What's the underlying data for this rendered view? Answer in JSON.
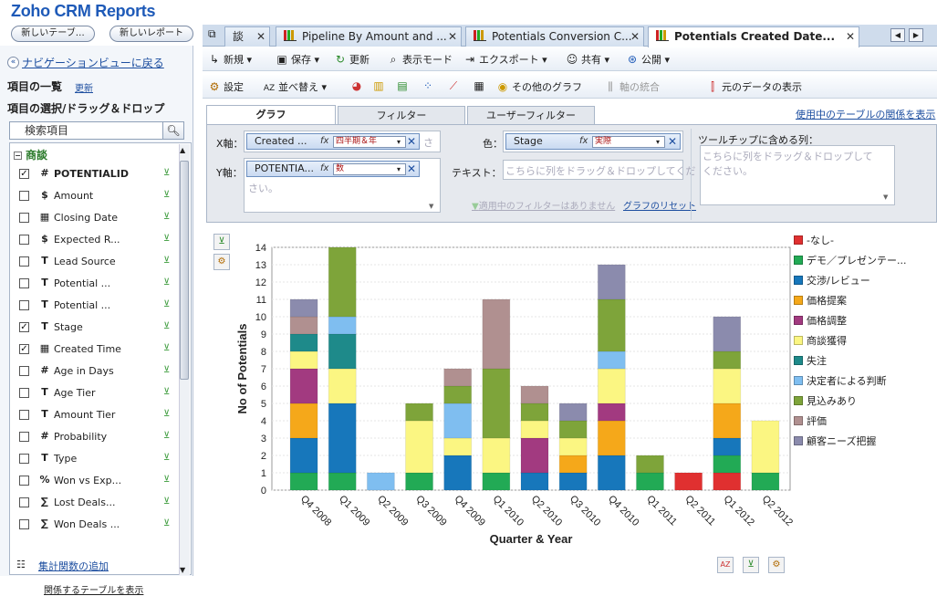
{
  "header": {
    "title": "Zoho CRM Reports",
    "new_table": "新しいテーブ…",
    "new_report": "新しいレポート"
  },
  "sidebar": {
    "nav_back": "ナビゲーションビューに戻る",
    "items_heading": "項目の一覧",
    "refresh": "更新",
    "sub_heading": "項目の選択/ドラッグ＆ドロップ",
    "search_placeholder": "検索項目",
    "group_title": "商談",
    "items": [
      {
        "label": "POTENTIALID",
        "type_icon": "#",
        "checked": true,
        "bold": true
      },
      {
        "label": "Amount",
        "type_icon": "$",
        "checked": false
      },
      {
        "label": "Closing Date",
        "type_icon": "calendar-icon",
        "checked": false
      },
      {
        "label": "Expected R...",
        "type_icon": "$",
        "checked": false
      },
      {
        "label": "Lead Source",
        "type_icon": "T",
        "checked": false
      },
      {
        "label": "Potential ...",
        "type_icon": "T",
        "checked": false
      },
      {
        "label": "Potential ...",
        "type_icon": "T",
        "checked": false
      },
      {
        "label": "Stage",
        "type_icon": "T",
        "checked": true
      },
      {
        "label": "Created Time",
        "type_icon": "calendar-icon",
        "checked": true
      },
      {
        "label": "Age in Days",
        "type_icon": "#",
        "checked": false
      },
      {
        "label": "Age Tier",
        "type_icon": "T",
        "checked": false
      },
      {
        "label": "Amount Tier",
        "type_icon": "T",
        "checked": false
      },
      {
        "label": "Probability",
        "type_icon": "#",
        "checked": false
      },
      {
        "label": "Type",
        "type_icon": "T",
        "checked": false
      },
      {
        "label": "Won vs Exp...",
        "type_icon": "%",
        "checked": false
      },
      {
        "label": "Lost Deals...",
        "type_icon": "formula-icon",
        "checked": false
      },
      {
        "label": "Won Deals ...",
        "type_icon": "formula-icon",
        "checked": false
      }
    ],
    "show_related": "関係するテーブルを表示",
    "add_aggregate": "集計関数の追加"
  },
  "tabs": [
    {
      "label": "談",
      "active": false
    },
    {
      "label": "Pipeline By Amount and ...",
      "active": false
    },
    {
      "label": "Potentials Conversion C...",
      "active": false
    },
    {
      "label": "Potentials Created Date...",
      "active": true
    }
  ],
  "toolbar1": {
    "new": "新規",
    "save": "保存",
    "refresh": "更新",
    "view_mode": "表示モード",
    "export": "エクスポート",
    "share": "共有",
    "publish": "公開"
  },
  "toolbar2": {
    "settings": "設定",
    "sort": "並べ替え",
    "other_charts": "その他のグラフ",
    "axis_merge": "軸の統合",
    "show_data": "元のデータの表示"
  },
  "config": {
    "tabs": [
      "グラフ",
      "フィルター",
      "ユーザーフィルター"
    ],
    "used_tables_link": "使用中のテーブルの関係を表示",
    "x_label": "X軸：",
    "x_pill": "Created ...",
    "x_func": "四半期＆年",
    "x_trailing": "さ",
    "y_label": "Y軸：",
    "y_pill": "POTENTIA...",
    "y_func": "数",
    "y_placeholder": "さい。",
    "color_label": "色：",
    "color_pill": "Stage",
    "color_func": "実際",
    "text_label": "テキスト：",
    "text_placeholder": "こちらに列をドラッグ＆ドロップしてくだ",
    "tooltip_label": "ツールチップに含める列：",
    "tooltip_placeholder": "こちらに列をドラッグ＆ドロップしてください。",
    "no_filter": "適用中のフィルターはありません",
    "reset_chart": "グラフのリセット"
  },
  "chart_data": {
    "type": "bar",
    "stacked": true,
    "xlabel": "Quarter & Year",
    "ylabel": "No of Potentials",
    "ylim": [
      0,
      14
    ],
    "yticks": [
      0,
      1,
      2,
      3,
      4,
      5,
      6,
      7,
      8,
      9,
      10,
      11,
      12,
      13,
      14
    ],
    "grid": true,
    "legend_placement": "right",
    "categories": [
      "Q4 2008",
      "Q1 2009",
      "Q2 2009",
      "Q3 2009",
      "Q4 2009",
      "Q1 2010",
      "Q2 2010",
      "Q3 2010",
      "Q4 2010",
      "Q1 2011",
      "Q2 2011",
      "Q1 2012",
      "Q2 2012"
    ],
    "series": [
      {
        "name": "-なし-",
        "color": "#e03030",
        "values": [
          0,
          0,
          0,
          0,
          0,
          0,
          0,
          0,
          0,
          0,
          1,
          1,
          0
        ]
      },
      {
        "name": "デモ／プレゼンテー...",
        "color": "#22aa55",
        "values": [
          1,
          1,
          0,
          1,
          0,
          1,
          0,
          0,
          0,
          1,
          0,
          1,
          1
        ]
      },
      {
        "name": "交渉/レビュー",
        "color": "#1777bb",
        "values": [
          2,
          4,
          0,
          0,
          2,
          0,
          1,
          1,
          2,
          0,
          0,
          1,
          0
        ]
      },
      {
        "name": "価格提案",
        "color": "#f5a81a",
        "values": [
          2,
          0,
          0,
          0,
          0,
          0,
          0,
          1,
          2,
          0,
          0,
          2,
          0
        ]
      },
      {
        "name": "価格調整",
        "color": "#a23a80",
        "values": [
          2,
          0,
          0,
          0,
          0,
          0,
          2,
          0,
          1,
          0,
          0,
          0,
          0
        ]
      },
      {
        "name": "商談獲得",
        "color": "#fbf682",
        "values": [
          1,
          2,
          0,
          3,
          1,
          2,
          1,
          1,
          2,
          0,
          0,
          2,
          3
        ]
      },
      {
        "name": "失注",
        "color": "#1e8a8a",
        "values": [
          1,
          2,
          0,
          0,
          0,
          0,
          0,
          0,
          0,
          0,
          0,
          0,
          0
        ]
      },
      {
        "name": "決定者による判断",
        "color": "#7fbef0",
        "values": [
          0,
          1,
          1,
          0,
          2,
          0,
          0,
          0,
          1,
          0,
          0,
          0,
          0
        ]
      },
      {
        "name": "見込みあり",
        "color": "#7ea43a",
        "values": [
          0,
          4,
          0,
          1,
          1,
          4,
          1,
          1,
          3,
          1,
          0,
          1,
          0
        ]
      },
      {
        "name": "評価",
        "color": "#b09090",
        "values": [
          1,
          0,
          0,
          0,
          1,
          4,
          1,
          0,
          0,
          0,
          0,
          0,
          0
        ]
      },
      {
        "name": "顧客ニーズ把握",
        "color": "#8b8bad",
        "values": [
          1,
          0,
          0,
          0,
          0,
          0,
          0,
          1,
          2,
          0,
          0,
          2,
          0
        ]
      }
    ]
  }
}
